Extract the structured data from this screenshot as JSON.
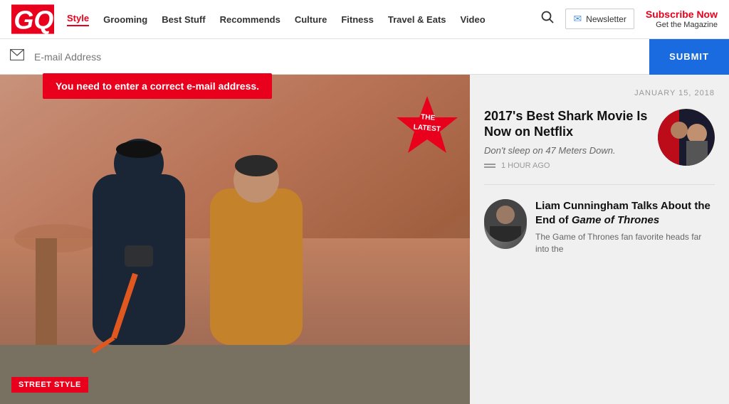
{
  "header": {
    "logo_text": "GQ",
    "nav_items": [
      {
        "label": "Style",
        "active": true
      },
      {
        "label": "Grooming",
        "active": false
      },
      {
        "label": "Best Stuff",
        "active": false
      },
      {
        "label": "Recommends",
        "active": false
      },
      {
        "label": "Culture",
        "active": false
      },
      {
        "label": "Fitness",
        "active": false
      },
      {
        "label": "Travel & Eats",
        "active": false
      },
      {
        "label": "Video",
        "active": false
      }
    ],
    "newsletter_label": "Newsletter",
    "subscribe_now": "Subscribe Now",
    "get_magazine": "Get the Magazine"
  },
  "email_bar": {
    "placeholder": "E-mail Address",
    "submit_label": "SUBMIT"
  },
  "error": {
    "message": "You need to enter a correct e-mail address."
  },
  "hero": {
    "badge_line1": "THE",
    "badge_line2": "LATEST",
    "street_style_label": "Street Style"
  },
  "sidebar": {
    "date": "JANUARY 15, 2018",
    "article1": {
      "title": "2017's Best Shark Movie Is Now on Netflix",
      "subtitle": "Don't sleep on 47 Meters Down.",
      "time_ago": "1 HOUR AGO"
    },
    "article2": {
      "title": "Liam Cunningham Talks About the End of Game of Thrones",
      "subtitle": "The Game of Thrones fan favorite heads far into the"
    }
  },
  "colors": {
    "red": "#e8001c",
    "blue": "#1a6ae0",
    "dark": "#111111",
    "mid": "#666666",
    "light": "#999999"
  }
}
